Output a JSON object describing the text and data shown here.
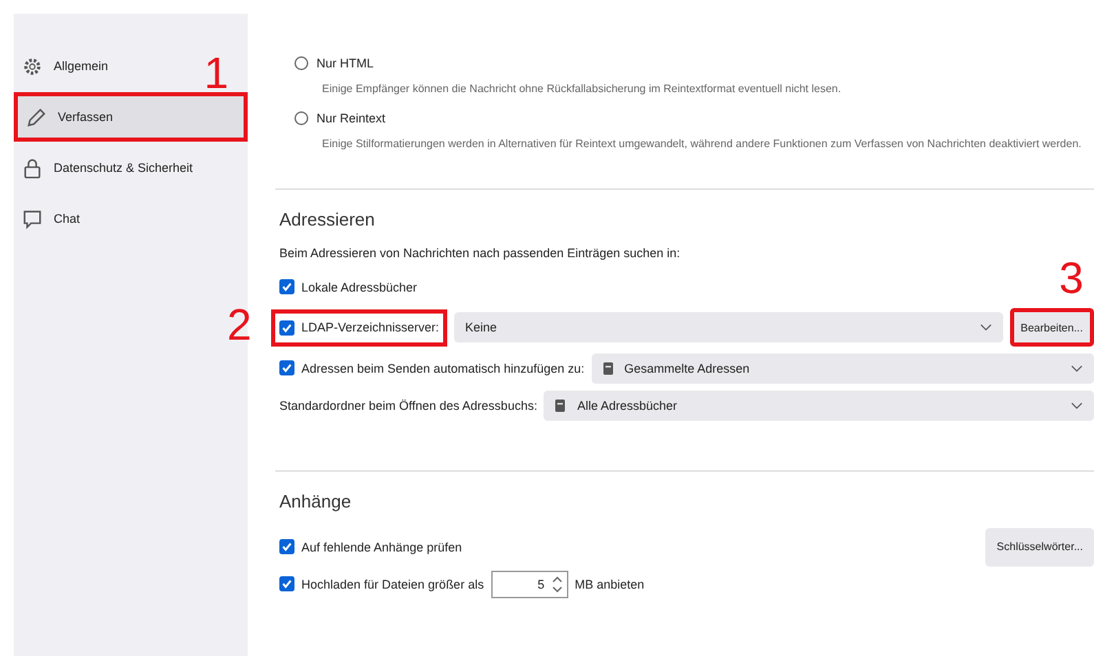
{
  "sidebar": {
    "items": [
      {
        "label": "Allgemein",
        "selected": false,
        "highlighted": false
      },
      {
        "label": "Verfassen",
        "selected": true,
        "highlighted": true,
        "annotation": "1"
      },
      {
        "label": "Datenschutz & Sicherheit",
        "selected": false,
        "highlighted": false
      },
      {
        "label": "Chat",
        "selected": false,
        "highlighted": false
      }
    ]
  },
  "format": {
    "options": [
      {
        "label": "Nur HTML",
        "selected": false,
        "description": "Einige Empfänger können die Nachricht ohne Rückfallabsicherung im Reintextformat eventuell nicht lesen."
      },
      {
        "label": "Nur Reintext",
        "selected": false,
        "description": "Einige Stilformatierungen werden in Alternativen für Reintext umgewandelt, während andere Funktionen zum Verfassen von Nachrichten deaktiviert werden."
      }
    ]
  },
  "addressing": {
    "title": "Adressieren",
    "intro": "Beim Adressieren von Nachrichten nach passenden Einträgen suchen in:",
    "local": {
      "label": "Lokale Adressbücher",
      "checked": true
    },
    "ldap": {
      "label": "LDAP-Verzeichnisserver:",
      "checked": true,
      "highlighted": true,
      "annotation": "2",
      "value": "Keine",
      "button": {
        "label": "Bearbeiten...",
        "highlighted": true,
        "annotation": "3"
      }
    },
    "auto_add": {
      "label": "Adressen beim Senden automatisch hinzufügen zu:",
      "checked": true,
      "value": "Gesammelte Adressen"
    },
    "default_folder": {
      "label": "Standardordner beim Öffnen des Adressbuchs:",
      "value": "Alle Adressbücher"
    }
  },
  "attachments": {
    "title": "Anhänge",
    "check_missing": {
      "label": "Auf fehlende Anhänge prüfen",
      "checked": true,
      "button": "Schlüsselwörter..."
    },
    "upload": {
      "label": "Hochladen für Dateien größer als",
      "checked": true,
      "value": "5",
      "unit": "MB anbieten"
    }
  }
}
